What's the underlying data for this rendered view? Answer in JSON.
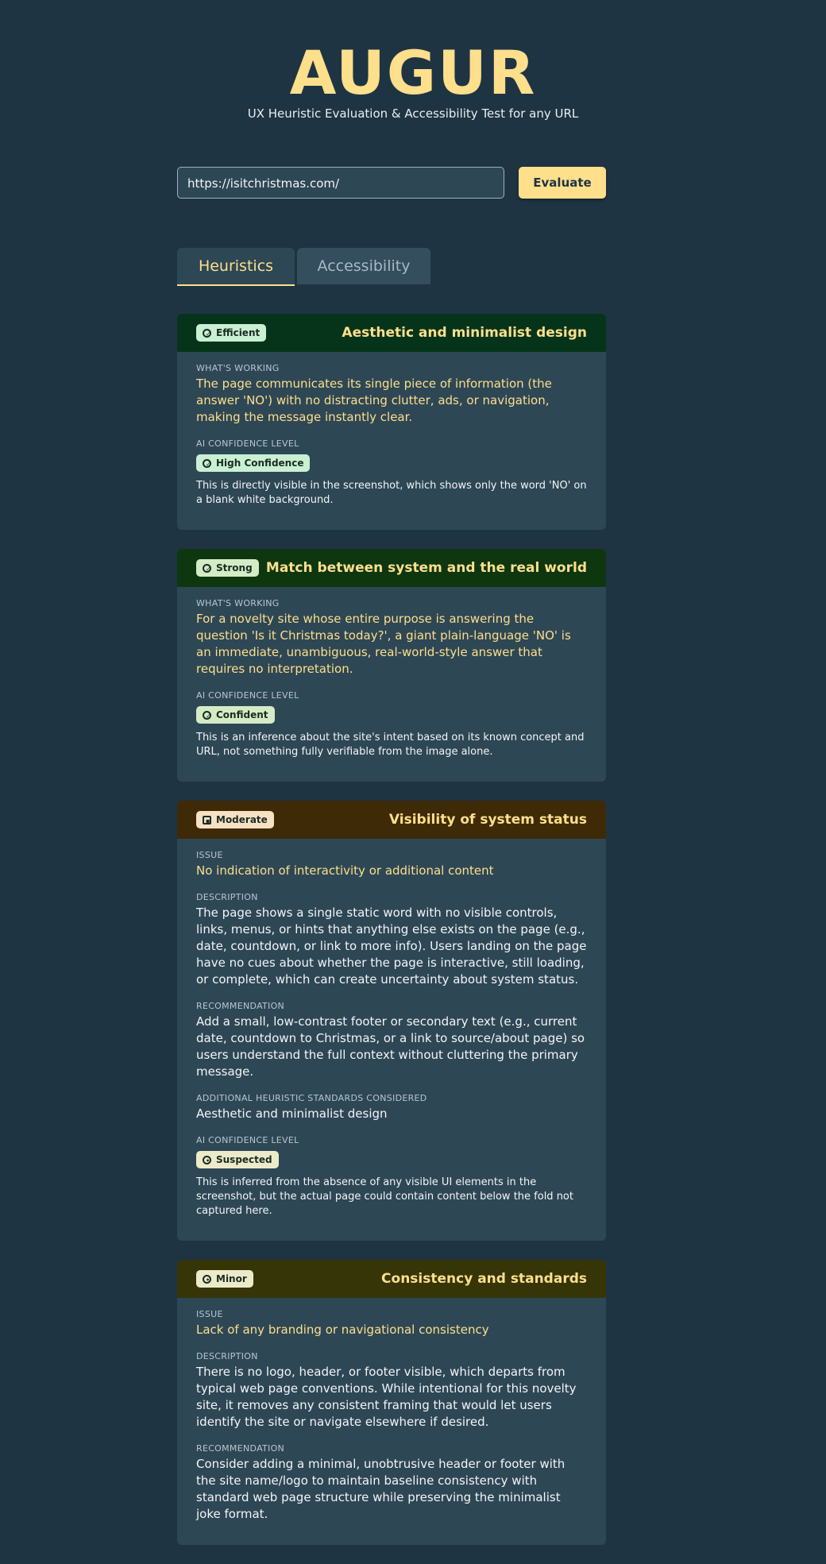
{
  "app": {
    "title": "AUGUR",
    "subtitle": "UX Heuristic Evaluation & Accessibility Test for any URL"
  },
  "search": {
    "value": "https://isitchristmas.com/",
    "button_label": "Evaluate"
  },
  "tabs": [
    {
      "label": "Heuristics",
      "active": true
    },
    {
      "label": "Accessibility",
      "active": false
    }
  ],
  "cards": [
    {
      "severity": "Efficient",
      "title": "Aesthetic and minimalist design",
      "whats_working_label": "WHAT'S WORKING",
      "whats_working": "The page communicates its single piece of information (the answer 'NO') with no distracting clutter, ads, or navigation, making the message instantly clear.",
      "confidence_label": "AI CONFIDENCE LEVEL",
      "confidence": "High Confidence",
      "confidence_note": "This is directly visible in the screenshot, which shows only the word 'NO' on a blank white background.",
      "header_color": "#06341a"
    },
    {
      "severity": "Strong",
      "title": "Match between system and the real world",
      "whats_working_label": "WHAT'S WORKING",
      "whats_working": "For a novelty site whose entire purpose is answering the question 'Is it Christmas today?', a giant plain-language 'NO' is an immediate, unambiguous, real-world-style answer that requires no interpretation.",
      "confidence_label": "AI CONFIDENCE LEVEL",
      "confidence": "Confident",
      "confidence_note": "This is an inference about the site's intent based on its known concept and URL, not something fully verifiable from the image alone.",
      "header_color": "#0e3710"
    },
    {
      "severity": "Moderate",
      "title": "Visibility of system status",
      "issue_label": "ISSUE",
      "issue": "No indication of interactivity or additional content",
      "description_label": "DESCRIPTION",
      "description": "The page shows a single static word with no visible controls, links, menus, or hints that anything else exists on the page (e.g., date, countdown, or link to more info). Users landing on the page have no cues about whether the page is interactive, still loading, or complete, which can create uncertainty about system status.",
      "recommendation_label": "RECOMMENDATION",
      "recommendation": "Add a small, low-contrast footer or secondary text (e.g., current date, countdown to Christmas, or a link to source/about page) so users understand the full context without cluttering the primary message.",
      "additional_label": "ADDITIONAL HEURISTIC STANDARDS CONSIDERED",
      "additional": "Aesthetic and minimalist design",
      "confidence_label": "AI CONFIDENCE LEVEL",
      "confidence": "Suspected",
      "confidence_note": "This is inferred from the absence of any visible UI elements in the screenshot, but the actual page could contain content below the fold not captured here.",
      "header_color": "#3f2a08"
    },
    {
      "severity": "Minor",
      "title": "Consistency and standards",
      "issue_label": "ISSUE",
      "issue": "Lack of any branding or navigational consistency",
      "description_label": "DESCRIPTION",
      "description": "There is no logo, header, or footer visible, which departs from typical web page conventions. While intentional for this novelty site, it removes any consistent framing that would let users identify the site or navigate elsewhere if desired.",
      "recommendation_label": "RECOMMENDATION",
      "recommendation": "Consider adding a minimal, unobtrusive header or footer with the site name/logo to maintain baseline consistency with standard web page structure while preserving the minimalist joke format.",
      "header_color": "#363508"
    }
  ],
  "colors": {
    "background": "#1f3442",
    "card": "#2e4755",
    "accent": "#fddf8c"
  }
}
